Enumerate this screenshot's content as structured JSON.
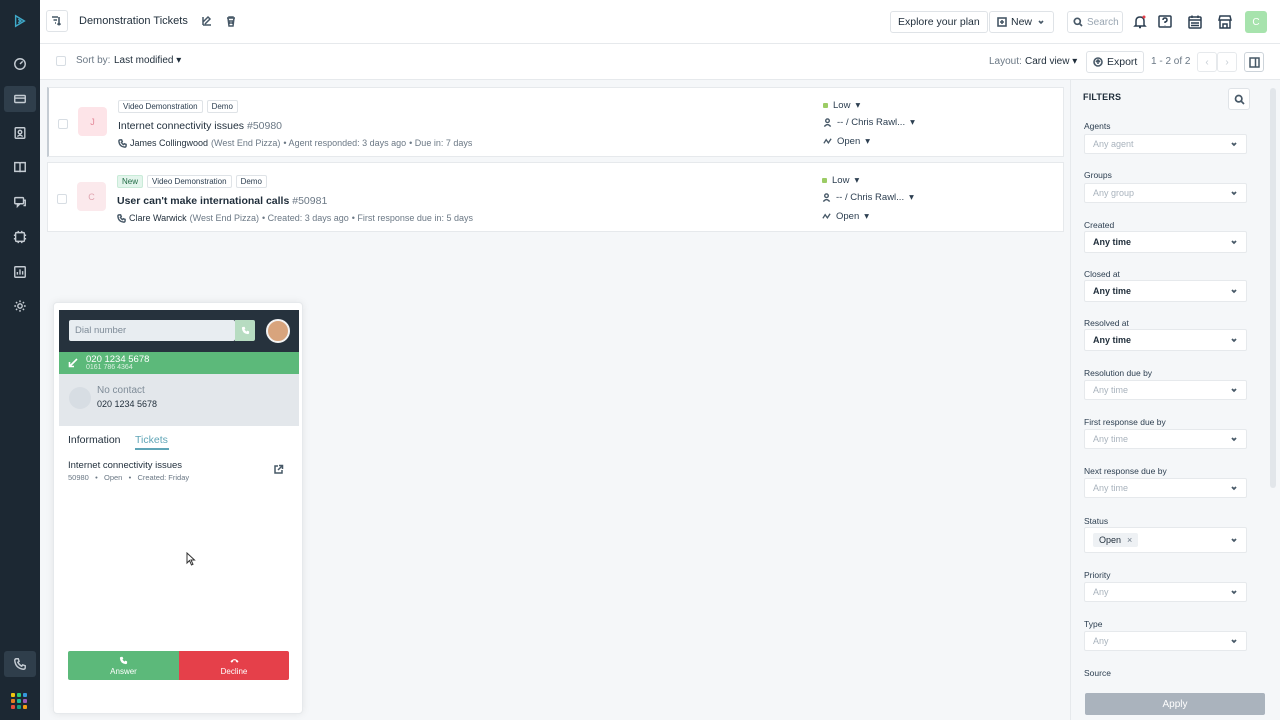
{
  "topbar": {
    "title": "Demonstration Tickets",
    "explore_label": "Explore your plan",
    "new_label": "New",
    "search_placeholder": "Search",
    "avatar_initial": "C"
  },
  "sortbar": {
    "sort_label": "Sort by:",
    "sort_value": "Last modified",
    "layout_label": "Layout:",
    "layout_value": "Card view",
    "export_label": "Export",
    "pager_text": "1 - 2 of 2"
  },
  "tickets": [
    {
      "initial": "J",
      "avatar_bg": "#fde4e8",
      "avatar_color": "#e58a9a",
      "tags": [
        "Video Demonstration",
        "Demo"
      ],
      "subject": "Internet connectivity issues",
      "number": "#50980",
      "requester": "James Collingwood",
      "company": "(West End Pizza)",
      "activity": "• Agent responded: 3 days ago",
      "due": "• Due in: 7 days",
      "priority": "Low",
      "assignee": "-- / Chris Rawl...",
      "status": "Open"
    },
    {
      "initial": "C",
      "avatar_bg": "#fbe9ec",
      "avatar_color": "#e0a5b0",
      "new_tag": "New",
      "tags": [
        "Video Demonstration",
        "Demo"
      ],
      "subject": "User can't make international calls",
      "number": "#50981",
      "requester": "Clare Warwick",
      "company": "(West End Pizza)",
      "activity": "• Created: 3 days ago",
      "due": "• First response due in: 5 days",
      "priority": "Low",
      "assignee": "-- / Chris Rawl...",
      "status": "Open"
    }
  ],
  "filters": {
    "title": "FILTERS",
    "agents_label": "Agents",
    "agents_value": "Any agent",
    "groups_label": "Groups",
    "groups_value": "Any group",
    "created_label": "Created",
    "created_value": "Any time",
    "closed_label": "Closed at",
    "closed_value": "Any time",
    "resolved_label": "Resolved at",
    "resolved_value": "Any time",
    "resolution_due_label": "Resolution due by",
    "resolution_due_value": "Any time",
    "first_response_label": "First response due by",
    "first_response_value": "Any time",
    "next_response_label": "Next response due by",
    "next_response_value": "Any time",
    "status_label": "Status",
    "status_chip": "Open",
    "status_chip_x": "×",
    "priority_label": "Priority",
    "priority_value": "Any",
    "type_label": "Type",
    "type_value": "Any",
    "source_label": "Source",
    "apply_label": "Apply"
  },
  "phone": {
    "dial_placeholder": "Dial number",
    "incoming_number": "020 1234 5678",
    "incoming_sub": "0161 786 4364",
    "contact_name": "No contact",
    "contact_number": "020 1234 5678",
    "tab_info": "Information",
    "tab_tickets": "Tickets",
    "ticket_title": "Internet connectivity issues",
    "ticket_meta": "50980   •   Open   •   Created: Friday",
    "answer_label": "Answer",
    "decline_label": "Decline"
  },
  "colors": {
    "rail": "#1c2833",
    "accent_green": "#5cb97a",
    "decline_red": "#e5404a",
    "tab_accent": "#5fa5b7"
  }
}
